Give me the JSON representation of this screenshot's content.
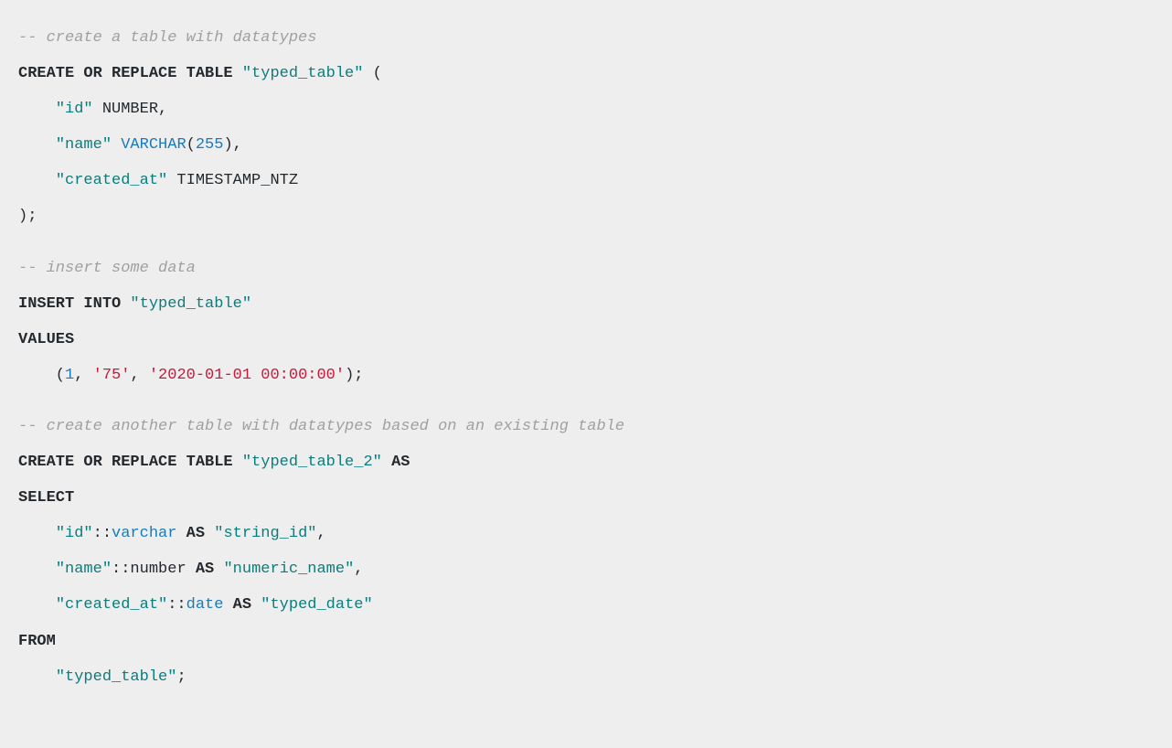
{
  "lines": [
    {
      "spans": [
        {
          "cls": "comment",
          "t": "-- create a table with datatypes"
        }
      ]
    },
    {
      "spans": [
        {
          "cls": "keyword",
          "t": "CREATE OR REPLACE TABLE"
        },
        {
          "cls": "plain",
          "t": " "
        },
        {
          "cls": "string",
          "t": "\"typed_table\""
        },
        {
          "cls": "plain",
          "t": " ("
        }
      ]
    },
    {
      "spans": [
        {
          "cls": "plain",
          "t": "    "
        },
        {
          "cls": "string",
          "t": "\"id\""
        },
        {
          "cls": "plain",
          "t": " NUMBER,"
        }
      ]
    },
    {
      "spans": [
        {
          "cls": "plain",
          "t": "    "
        },
        {
          "cls": "string",
          "t": "\"name\""
        },
        {
          "cls": "plain",
          "t": " "
        },
        {
          "cls": "type",
          "t": "VARCHAR"
        },
        {
          "cls": "plain",
          "t": "("
        },
        {
          "cls": "number",
          "t": "255"
        },
        {
          "cls": "plain",
          "t": "),"
        }
      ]
    },
    {
      "spans": [
        {
          "cls": "plain",
          "t": "    "
        },
        {
          "cls": "string",
          "t": "\"created_at\""
        },
        {
          "cls": "plain",
          "t": " TIMESTAMP_NTZ"
        }
      ]
    },
    {
      "spans": [
        {
          "cls": "plain",
          "t": ");"
        }
      ]
    },
    {
      "blank": true
    },
    {
      "spans": [
        {
          "cls": "comment",
          "t": "-- insert some data"
        }
      ]
    },
    {
      "spans": [
        {
          "cls": "keyword",
          "t": "INSERT INTO"
        },
        {
          "cls": "plain",
          "t": " "
        },
        {
          "cls": "string",
          "t": "\"typed_table\""
        }
      ]
    },
    {
      "spans": [
        {
          "cls": "keyword",
          "t": "VALUES"
        }
      ]
    },
    {
      "spans": [
        {
          "cls": "plain",
          "t": "    ("
        },
        {
          "cls": "number",
          "t": "1"
        },
        {
          "cls": "plain",
          "t": ", "
        },
        {
          "cls": "literal",
          "t": "'75'"
        },
        {
          "cls": "plain",
          "t": ", "
        },
        {
          "cls": "literal",
          "t": "'2020-01-01 00:00:00'"
        },
        {
          "cls": "plain",
          "t": ");"
        }
      ]
    },
    {
      "blank": true
    },
    {
      "spans": [
        {
          "cls": "comment",
          "t": "-- create another table with datatypes based on an existing table"
        }
      ]
    },
    {
      "spans": [
        {
          "cls": "keyword",
          "t": "CREATE OR REPLACE TABLE"
        },
        {
          "cls": "plain",
          "t": " "
        },
        {
          "cls": "string",
          "t": "\"typed_table_2\""
        },
        {
          "cls": "plain",
          "t": " "
        },
        {
          "cls": "keyword",
          "t": "AS"
        }
      ]
    },
    {
      "spans": [
        {
          "cls": "keyword",
          "t": "SELECT"
        }
      ]
    },
    {
      "spans": [
        {
          "cls": "plain",
          "t": "    "
        },
        {
          "cls": "string",
          "t": "\"id\""
        },
        {
          "cls": "plain",
          "t": "::"
        },
        {
          "cls": "type",
          "t": "varchar"
        },
        {
          "cls": "plain",
          "t": " "
        },
        {
          "cls": "keyword",
          "t": "AS"
        },
        {
          "cls": "plain",
          "t": " "
        },
        {
          "cls": "string",
          "t": "\"string_id\""
        },
        {
          "cls": "plain",
          "t": ","
        }
      ]
    },
    {
      "spans": [
        {
          "cls": "plain",
          "t": "    "
        },
        {
          "cls": "string",
          "t": "\"name\""
        },
        {
          "cls": "plain",
          "t": "::number "
        },
        {
          "cls": "keyword",
          "t": "AS"
        },
        {
          "cls": "plain",
          "t": " "
        },
        {
          "cls": "string",
          "t": "\"numeric_name\""
        },
        {
          "cls": "plain",
          "t": ","
        }
      ]
    },
    {
      "spans": [
        {
          "cls": "plain",
          "t": "    "
        },
        {
          "cls": "string",
          "t": "\"created_at\""
        },
        {
          "cls": "plain",
          "t": "::"
        },
        {
          "cls": "type",
          "t": "date"
        },
        {
          "cls": "plain",
          "t": " "
        },
        {
          "cls": "keyword",
          "t": "AS"
        },
        {
          "cls": "plain",
          "t": " "
        },
        {
          "cls": "string",
          "t": "\"typed_date\""
        }
      ]
    },
    {
      "spans": [
        {
          "cls": "keyword",
          "t": "FROM"
        }
      ]
    },
    {
      "spans": [
        {
          "cls": "plain",
          "t": "    "
        },
        {
          "cls": "string",
          "t": "\"typed_table\""
        },
        {
          "cls": "plain",
          "t": ";"
        }
      ]
    }
  ]
}
